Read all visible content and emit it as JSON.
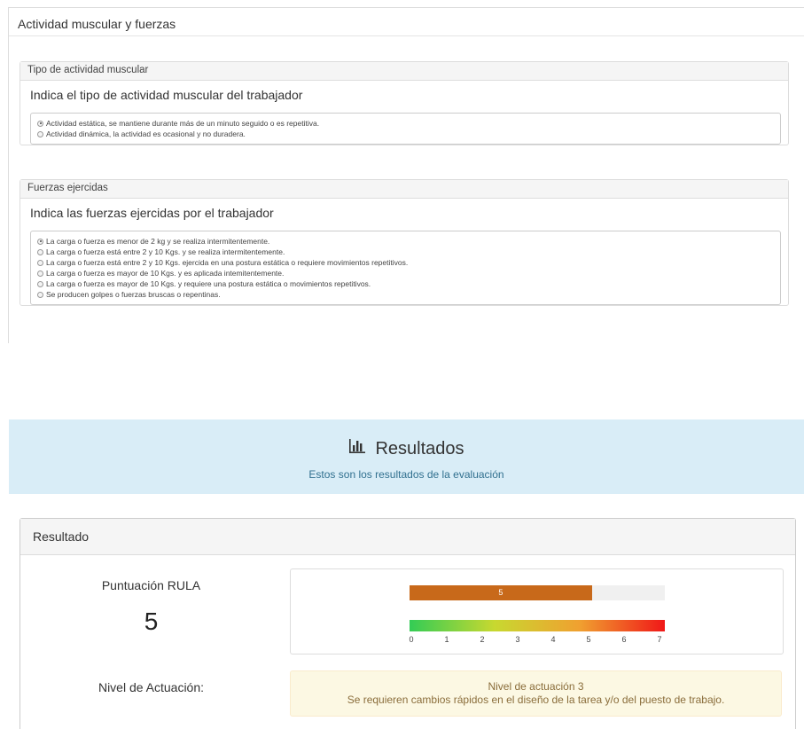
{
  "top_panel": {
    "title": "Actividad muscular y fuerzas",
    "muscle": {
      "header": "Tipo de actividad muscular",
      "question": "Indica el tipo de actividad muscular del trabajador",
      "options": [
        {
          "label": "Actividad estática, se mantiene durante más de un minuto seguido o es repetitiva.",
          "selected": true
        },
        {
          "label": "Actividad dinámica, la actividad es ocasional y no duradera.",
          "selected": false
        }
      ]
    },
    "forces": {
      "header": "Fuerzas ejercidas",
      "question": "Indica las fuerzas ejercidas por el trabajador",
      "options": [
        {
          "label": "La carga o fuerza es menor de 2 kg y se realiza intermitentemente.",
          "selected": true
        },
        {
          "label": "La carga o fuerza está entre 2 y 10 Kgs. y se realiza intermitentemente.",
          "selected": false
        },
        {
          "label": "La carga o fuerza está entre 2 y 10 Kgs. ejercida en una postura estática o requiere movimientos repetitivos.",
          "selected": false
        },
        {
          "label": "La carga o fuerza es mayor de 10 Kgs. y es aplicada intemitentemente.",
          "selected": false
        },
        {
          "label": "La carga o fuerza es mayor de 10 Kgs. y requiere una postura estática o movimientos repetitivos.",
          "selected": false
        },
        {
          "label": "Se producen golpes o fuerzas bruscas o repentinas.",
          "selected": false
        }
      ]
    }
  },
  "results": {
    "icon": "bar-chart-icon",
    "title": "Resultados",
    "subtitle": "Estos son los resultados de la evaluación",
    "panel_title": "Resultado",
    "score_label": "Puntuación RULA",
    "score": "5",
    "score_bar": {
      "value": 5,
      "max": 7,
      "label": "5"
    },
    "scale_ticks": [
      "0",
      "1",
      "2",
      "3",
      "4",
      "5",
      "6",
      "7"
    ],
    "level_label": "Nivel de Actuación:",
    "level_title": "Nivel de actuación 3",
    "level_text": "Se requieren cambios rápidos en el diseño de la tarea y/o del puesto de trabajo."
  },
  "colors": {
    "bar_fill": "#c8691a",
    "header_bg": "#d9edf7",
    "alert_bg": "#fcf8e3",
    "alert_text": "#8a6d3b"
  }
}
